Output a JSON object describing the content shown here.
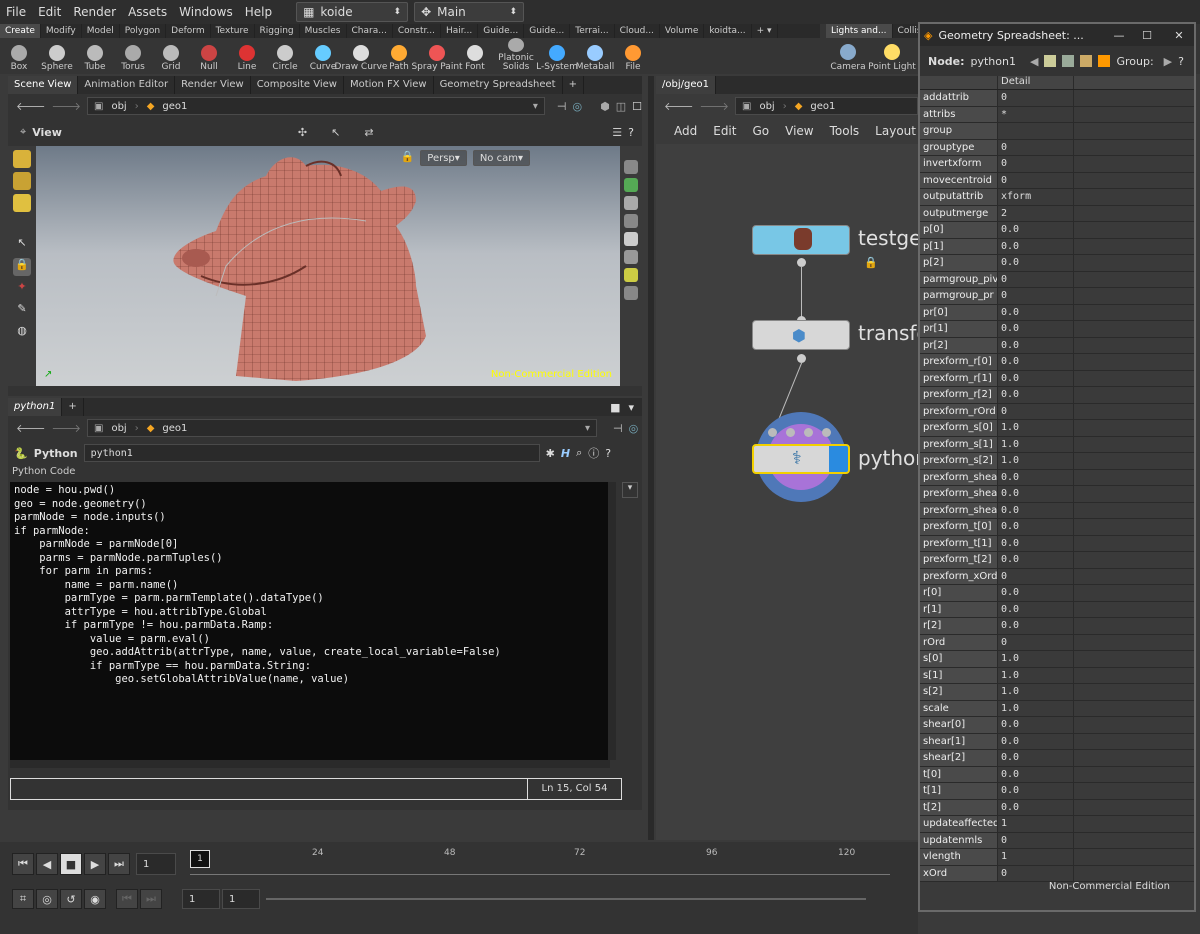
{
  "menu": [
    "File",
    "Edit",
    "Render",
    "Assets",
    "Windows",
    "Help"
  ],
  "desktop": {
    "context": "koide",
    "label": "Main"
  },
  "shelf_tabs": [
    "Create",
    "Modify",
    "Model",
    "Polygon",
    "Deform",
    "Texture",
    "Rigging",
    "Muscles",
    "Chara...",
    "Constr...",
    "Hair...",
    "Guide...",
    "Guide...",
    "Terrai...",
    "Cloud...",
    "Volume",
    "koidta..."
  ],
  "shelf_tools": [
    "Box",
    "Sphere",
    "Tube",
    "Torus",
    "Grid",
    "Null",
    "Line",
    "Circle",
    "Curve",
    "Draw Curve",
    "Path",
    "Spray Paint",
    "Font",
    "Platonic Solids",
    "L-System",
    "Metaball",
    "File"
  ],
  "shelf2_tabs": [
    "Lights and...",
    "Collis"
  ],
  "shelf2_tools": [
    "Camera",
    "Point Light"
  ],
  "left_tabs": [
    "Scene View",
    "Animation Editor",
    "Render View",
    "Composite View",
    "Motion FX View",
    "Geometry Spreadsheet"
  ],
  "path": {
    "obj": "obj",
    "geo": "geo1"
  },
  "viewer": {
    "title": "View",
    "persp": "Persp",
    "cam": "No cam",
    "watermark": "Non-Commercial Edition"
  },
  "python_tab": "python1",
  "python_pane": {
    "label": "Python",
    "node_name": "python1",
    "code_label": "Python Code",
    "status": "Ln 15, Col 54"
  },
  "code_lines": [
    "node = hou.pwd()",
    "geo = node.geometry()",
    "parmNode = node.inputs()",
    "if parmNode:",
    "    parmNode = parmNode[0]",
    "    parms = parmNode.parmTuples()",
    "    for parm in parms:",
    "        name = parm.name()",
    "        parmType = parm.parmTemplate().dataType()",
    "        attrType = hou.attribType.Global",
    "        if parmType != hou.parmData.Ramp:",
    "            value = parm.eval()",
    "            geo.addAttrib(attrType, name, value, create_local_variable=False)",
    "            if parmType == hou.parmData.String:",
    "                geo.setGlobalAttribValue(name, value)"
  ],
  "network": {
    "tab": "/obj/geo1",
    "menus": [
      "Add",
      "Edit",
      "Go",
      "View",
      "Tools",
      "Layout"
    ],
    "nodes": [
      "testge",
      "transfo",
      "python"
    ]
  },
  "timeline": {
    "frame": "1",
    "ticks": [
      "24",
      "48",
      "72",
      "96",
      "120"
    ],
    "start": "1",
    "end": "1"
  },
  "spreadsheet": {
    "title": "Geometry Spreadsheet: ...",
    "node_label": "Node:",
    "node": "python1",
    "group_label": "Group:",
    "column": "Detail",
    "watermark": "Non-Commercial Edition",
    "rows": [
      [
        "addattrib",
        "0"
      ],
      [
        "attribs",
        "*"
      ],
      [
        "group",
        ""
      ],
      [
        "grouptype",
        "0"
      ],
      [
        "invertxform",
        "0"
      ],
      [
        "movecentroid",
        "0"
      ],
      [
        "outputattrib",
        "xform"
      ],
      [
        "outputmerge",
        "2"
      ],
      [
        "p[0]",
        "0.0"
      ],
      [
        "p[1]",
        "0.0"
      ],
      [
        "p[2]",
        "0.0"
      ],
      [
        "parmgroup_piv",
        "0"
      ],
      [
        "parmgroup_pr",
        "0"
      ],
      [
        "pr[0]",
        "0.0"
      ],
      [
        "pr[1]",
        "0.0"
      ],
      [
        "pr[2]",
        "0.0"
      ],
      [
        "prexform_r[0]",
        "0.0"
      ],
      [
        "prexform_r[1]",
        "0.0"
      ],
      [
        "prexform_r[2]",
        "0.0"
      ],
      [
        "prexform_rOrd",
        "0"
      ],
      [
        "prexform_s[0]",
        "1.0"
      ],
      [
        "prexform_s[1]",
        "1.0"
      ],
      [
        "prexform_s[2]",
        "1.0"
      ],
      [
        "prexform_shea",
        "0.0"
      ],
      [
        "prexform_shea",
        "0.0"
      ],
      [
        "prexform_shea",
        "0.0"
      ],
      [
        "prexform_t[0]",
        "0.0"
      ],
      [
        "prexform_t[1]",
        "0.0"
      ],
      [
        "prexform_t[2]",
        "0.0"
      ],
      [
        "prexform_xOrd",
        "0"
      ],
      [
        "r[0]",
        "0.0"
      ],
      [
        "r[1]",
        "0.0"
      ],
      [
        "r[2]",
        "0.0"
      ],
      [
        "rOrd",
        "0"
      ],
      [
        "s[0]",
        "1.0"
      ],
      [
        "s[1]",
        "1.0"
      ],
      [
        "s[2]",
        "1.0"
      ],
      [
        "scale",
        "1.0"
      ],
      [
        "shear[0]",
        "0.0"
      ],
      [
        "shear[1]",
        "0.0"
      ],
      [
        "shear[2]",
        "0.0"
      ],
      [
        "t[0]",
        "0.0"
      ],
      [
        "t[1]",
        "0.0"
      ],
      [
        "t[2]",
        "0.0"
      ],
      [
        "updateaffected",
        "1"
      ],
      [
        "updatenmls",
        "0"
      ],
      [
        "vlength",
        "1"
      ],
      [
        "xOrd",
        "0"
      ]
    ]
  }
}
